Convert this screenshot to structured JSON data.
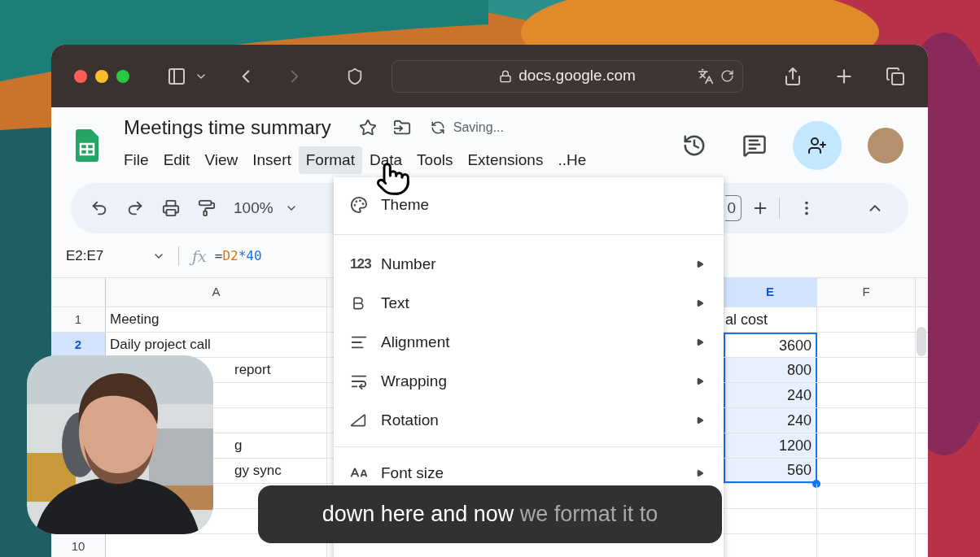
{
  "browser": {
    "address": "docs.google.com",
    "forward_disabled": true
  },
  "document": {
    "title": "Meetings time summary",
    "status": "Saving...",
    "menu": [
      {
        "label": "File",
        "selected": false
      },
      {
        "label": "Edit",
        "selected": false
      },
      {
        "label": "View",
        "selected": false
      },
      {
        "label": "Insert",
        "selected": false
      },
      {
        "label": "Format",
        "selected": true
      },
      {
        "label": "Data",
        "selected": false
      },
      {
        "label": "Tools",
        "selected": false
      },
      {
        "label": "Extensions",
        "selected": false
      },
      {
        "label": "..He",
        "selected": false
      }
    ]
  },
  "toolbar": {
    "zoom": "100%",
    "font_size": "0"
  },
  "formula_bar": {
    "name_box": "E2:E7",
    "function_label": "ƒx",
    "formula": [
      {
        "text": "=",
        "color": "#3c4043"
      },
      {
        "text": "D2",
        "color": "#e37400"
      },
      {
        "text": "*40",
        "color": "#1a73e8"
      }
    ]
  },
  "format_menu": [
    {
      "kind": "theme",
      "label": "Theme",
      "submenu": false
    },
    {
      "kind": "divider"
    },
    {
      "kind": "number",
      "glyph": "123",
      "label": "Number",
      "submenu": true
    },
    {
      "kind": "text",
      "label": "Text",
      "submenu": true
    },
    {
      "kind": "alignment",
      "label": "Alignment",
      "submenu": true
    },
    {
      "kind": "wrapping",
      "label": "Wrapping",
      "submenu": true
    },
    {
      "kind": "rotation",
      "label": "Rotation",
      "submenu": true
    },
    {
      "kind": "divider"
    },
    {
      "kind": "font_size",
      "label": "Font size",
      "submenu": true
    }
  ],
  "sheet": {
    "columns": [
      {
        "label": "A",
        "selected": false
      },
      {
        "label": "E",
        "selected": true
      },
      {
        "label": "F",
        "selected": false
      }
    ],
    "rows": [
      {
        "number": "1",
        "selected": false,
        "a": "Meeting",
        "e": "al cost"
      },
      {
        "number": "2",
        "selected": true,
        "a": "Daily project call",
        "e": "3600"
      },
      {
        "selected": true,
        "a": "report",
        "e": "800"
      },
      {
        "selected": true,
        "e": "240"
      },
      {
        "selected": true,
        "e": "240"
      },
      {
        "selected": true,
        "a": "g",
        "e": "1200"
      },
      {
        "selected": true,
        "a": "gy sync",
        "e": "560"
      },
      {
        "selected": false
      },
      {
        "selected": false
      },
      {
        "number": "10",
        "selected": false
      }
    ]
  },
  "caption": {
    "spoken": "down here and now",
    "upcoming": "we format it to"
  }
}
